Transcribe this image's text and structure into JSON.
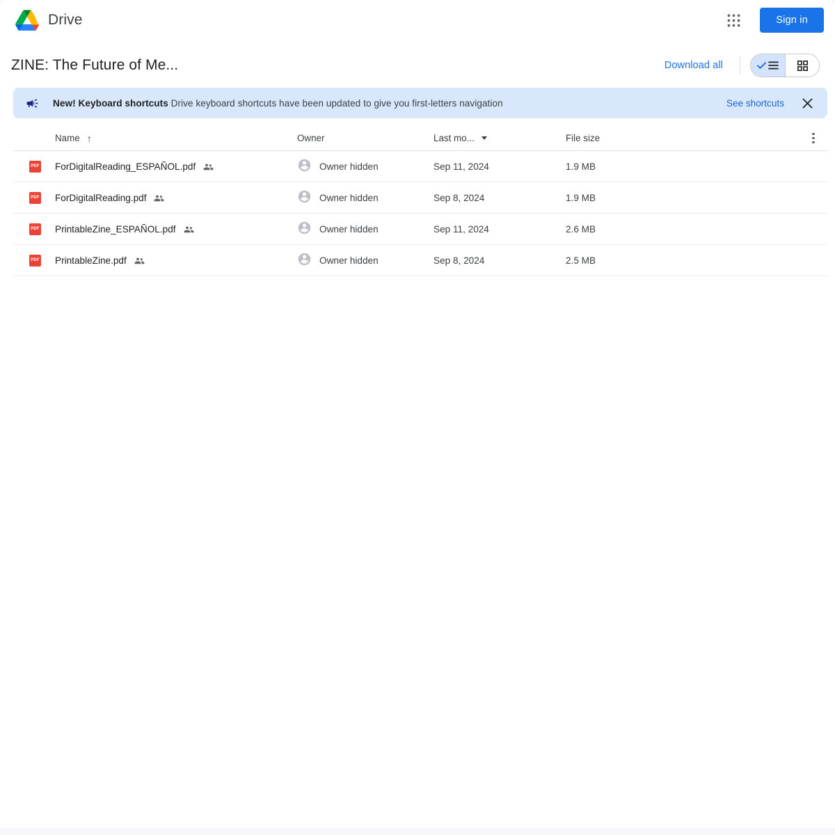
{
  "app": {
    "brand_name": "Drive",
    "logo_icon": "google-drive-logo",
    "colors": {
      "accent_blue": "#1a73e8",
      "link_blue": "#1967d2",
      "banner_bg": "#d9e7fd",
      "toggle_selected_bg": "#d3e3fd",
      "pdf_red": "#ea4335",
      "drive_green": "#0da960",
      "drive_yellow": "#ffcf63",
      "drive_blue": "#3777e3"
    }
  },
  "topbar": {
    "apps_icon": "apps-grid-icon",
    "signin_label": "Sign in"
  },
  "title_row": {
    "folder_title": "ZINE: The Future of Me...",
    "download_all_label": "Download all",
    "view_toggle": {
      "list_icon": "list-view-icon",
      "grid_icon": "grid-view-icon",
      "selected": "list"
    }
  },
  "banner": {
    "icon": "campaign-megaphone-icon",
    "headline": "New! Keyboard shortcuts",
    "message": "Drive keyboard shortcuts have been updated to give you first-letters navigation",
    "action_label": "See shortcuts",
    "close_icon": "close-icon"
  },
  "table": {
    "columns": {
      "name": "Name",
      "owner": "Owner",
      "modified": "Last mo...",
      "size": "File size"
    },
    "sort": {
      "column": "Name",
      "direction_icon": "arrow-up-icon"
    },
    "more_icon": "more-vertical-icon",
    "rows": [
      {
        "file_icon": "pdf-file-icon",
        "file_icon_label": "PDF",
        "name": "ForDigitalReading_ESPAÑOL.pdf",
        "shared_icon": "shared-people-icon",
        "owner_avatar": "account-circle-icon",
        "owner": "Owner hidden",
        "modified": "Sep 11, 2024",
        "size": "1.9 MB"
      },
      {
        "file_icon": "pdf-file-icon",
        "file_icon_label": "PDF",
        "name": "ForDigitalReading.pdf",
        "shared_icon": "shared-people-icon",
        "owner_avatar": "account-circle-icon",
        "owner": "Owner hidden",
        "modified": "Sep 8, 2024",
        "size": "1.9 MB"
      },
      {
        "file_icon": "pdf-file-icon",
        "file_icon_label": "PDF",
        "name": "PrintableZine_ESPAÑOL.pdf",
        "shared_icon": "shared-people-icon",
        "owner_avatar": "account-circle-icon",
        "owner": "Owner hidden",
        "modified": "Sep 11, 2024",
        "size": "2.6 MB"
      },
      {
        "file_icon": "pdf-file-icon",
        "file_icon_label": "PDF",
        "name": "PrintableZine.pdf",
        "shared_icon": "shared-people-icon",
        "owner_avatar": "account-circle-icon",
        "owner": "Owner hidden",
        "modified": "Sep 8, 2024",
        "size": "2.5 MB"
      }
    ]
  }
}
